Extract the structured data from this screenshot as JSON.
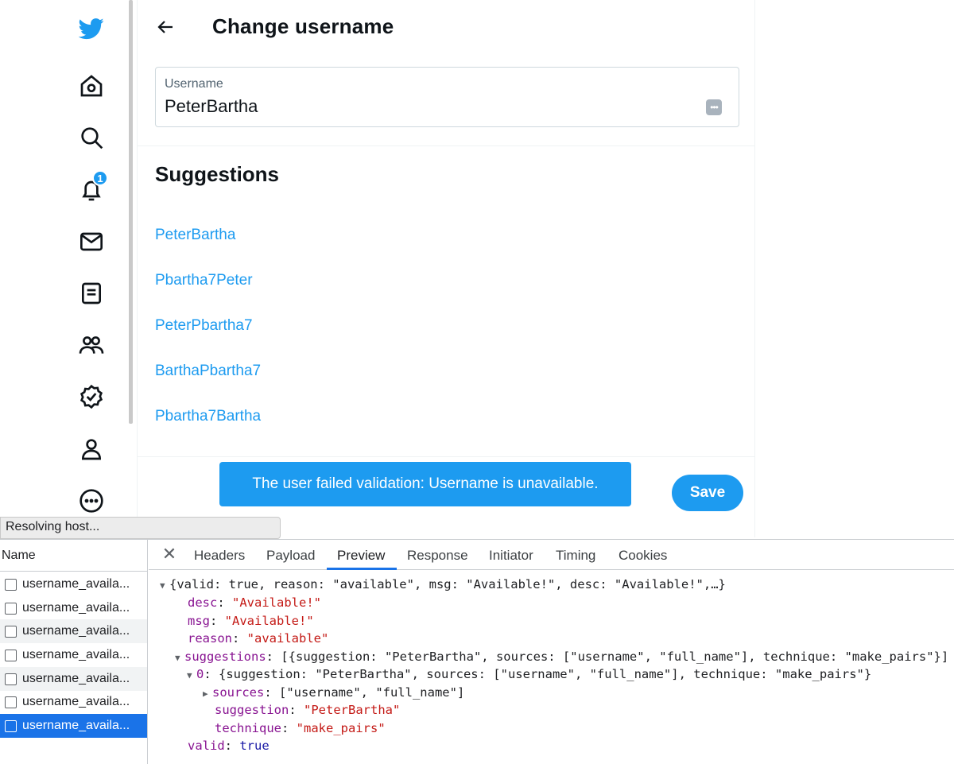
{
  "page": {
    "title": "Change username",
    "field_label": "Username",
    "field_value": "PeterBartha",
    "suggestions_title": "Suggestions",
    "suggestions": [
      "PeterBartha",
      "Pbartha7Peter",
      "PeterPbartha7",
      "BarthaPbartha7",
      "Pbartha7Bartha"
    ],
    "toast": "The user failed validation: Username is unavailable.",
    "save_label": "Save"
  },
  "nav": {
    "notification_count": "1",
    "icons": [
      "twitter-bird-icon",
      "home-icon",
      "search-icon",
      "bell-icon",
      "mail-icon",
      "list-icon",
      "communities-icon",
      "verified-icon",
      "profile-icon",
      "more-icon"
    ]
  },
  "status_bubble": "Resolving host...",
  "devtools": {
    "name_header": "Name",
    "requests": [
      "username_availa...",
      "username_availa...",
      "username_availa...",
      "username_availa...",
      "username_availa...",
      "username_availa...",
      "username_availa..."
    ],
    "tabs": [
      "Headers",
      "Payload",
      "Preview",
      "Response",
      "Initiator",
      "Timing",
      "Cookies"
    ],
    "active_tab": "Preview",
    "preview": {
      "summary": "{valid: true, reason: \"available\", msg: \"Available!\", desc: \"Available!\",…}",
      "desc": "\"Available!\"",
      "msg": "\"Available!\"",
      "reason": "\"available\"",
      "suggestions_summary": "[{suggestion: \"PeterBartha\", sources: [\"username\", \"full_name\"], technique: \"make_pairs\"}]",
      "item0_summary": "{suggestion: \"PeterBartha\", sources: [\"username\", \"full_name\"], technique: \"make_pairs\"}",
      "sources": "[\"username\", \"full_name\"]",
      "suggestion": "\"PeterBartha\"",
      "technique": "\"make_pairs\"",
      "valid": "true"
    },
    "keys": {
      "desc": "desc",
      "msg": "msg",
      "reason": "reason",
      "suggestions": "suggestions",
      "item0": "0",
      "sources": "sources",
      "suggestion": "suggestion",
      "technique": "technique",
      "valid": "valid"
    }
  },
  "colors": {
    "accent": "#1d9bf0",
    "devtools_selected": "#1a73e8",
    "json_key": "#881391",
    "json_string": "#c41a16"
  }
}
